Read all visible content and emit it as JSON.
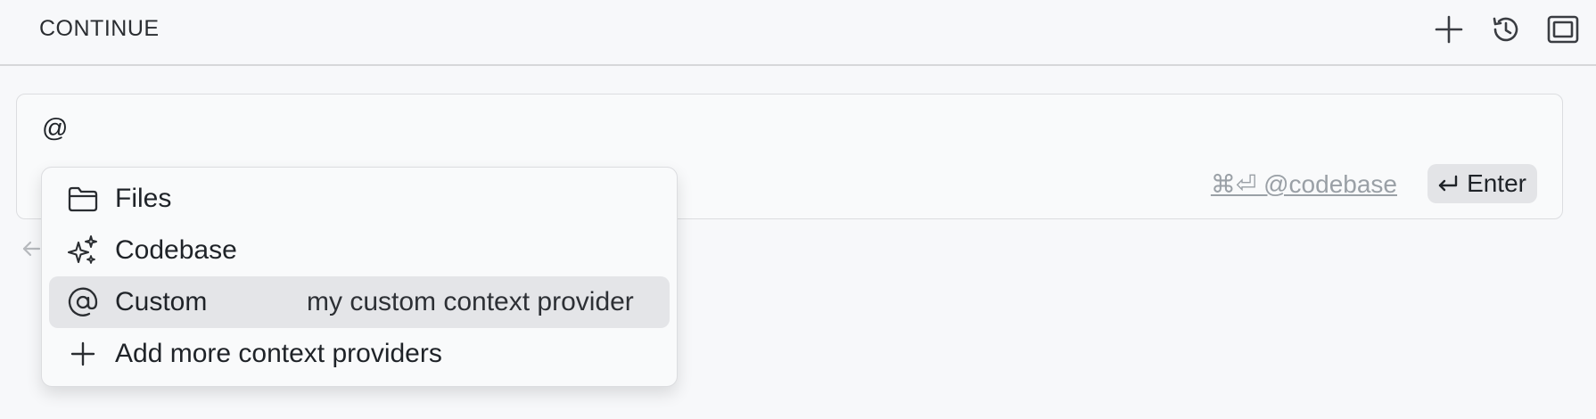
{
  "header": {
    "title": "CONTINUE",
    "actions": [
      {
        "icon": "plus-icon",
        "label": "New"
      },
      {
        "icon": "history-icon",
        "label": "History"
      },
      {
        "icon": "fullscreen-icon",
        "label": "Fullscreen"
      }
    ]
  },
  "input": {
    "value": "@",
    "codebase_hint": "⌘⏎ @codebase",
    "enter_label": "Enter",
    "enter_icon": "return-icon"
  },
  "dropdown": {
    "items": [
      {
        "label": "Files",
        "icon": "folder-icon",
        "description": ""
      },
      {
        "label": "Codebase",
        "icon": "sparkles-icon",
        "description": ""
      },
      {
        "label": "Custom",
        "icon": "at-icon",
        "description": "my custom context provider",
        "selected": true
      },
      {
        "label": "Add more context providers",
        "icon": "plus-icon",
        "description": ""
      }
    ]
  },
  "colors": {
    "background": "#f7f8fa",
    "selected_row": "#e4e5e8",
    "hint_text": "#9aa0a6"
  }
}
